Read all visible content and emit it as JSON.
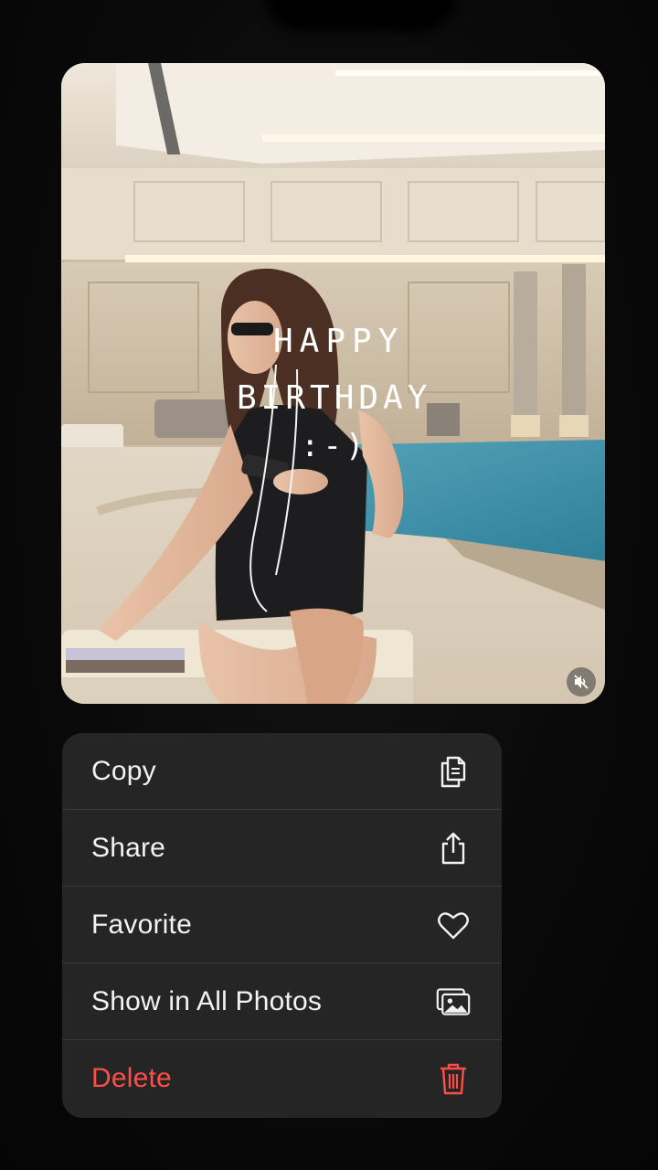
{
  "photo": {
    "caption_lines": [
      "HAPPY",
      "BIRTHDAY",
      ":-)"
    ],
    "mute_icon": "speaker-muted-icon"
  },
  "menu": {
    "items": [
      {
        "label": "Copy",
        "icon": "copy-icon"
      },
      {
        "label": "Share",
        "icon": "share-icon"
      },
      {
        "label": "Favorite",
        "icon": "heart-icon"
      },
      {
        "label": "Show in All Photos",
        "icon": "photos-icon"
      },
      {
        "label": "Delete",
        "icon": "trash-icon",
        "destructive": true
      }
    ]
  },
  "colors": {
    "destructive": "#ff4d47",
    "menu_background": "#252525",
    "text": "#f2f2f2"
  }
}
